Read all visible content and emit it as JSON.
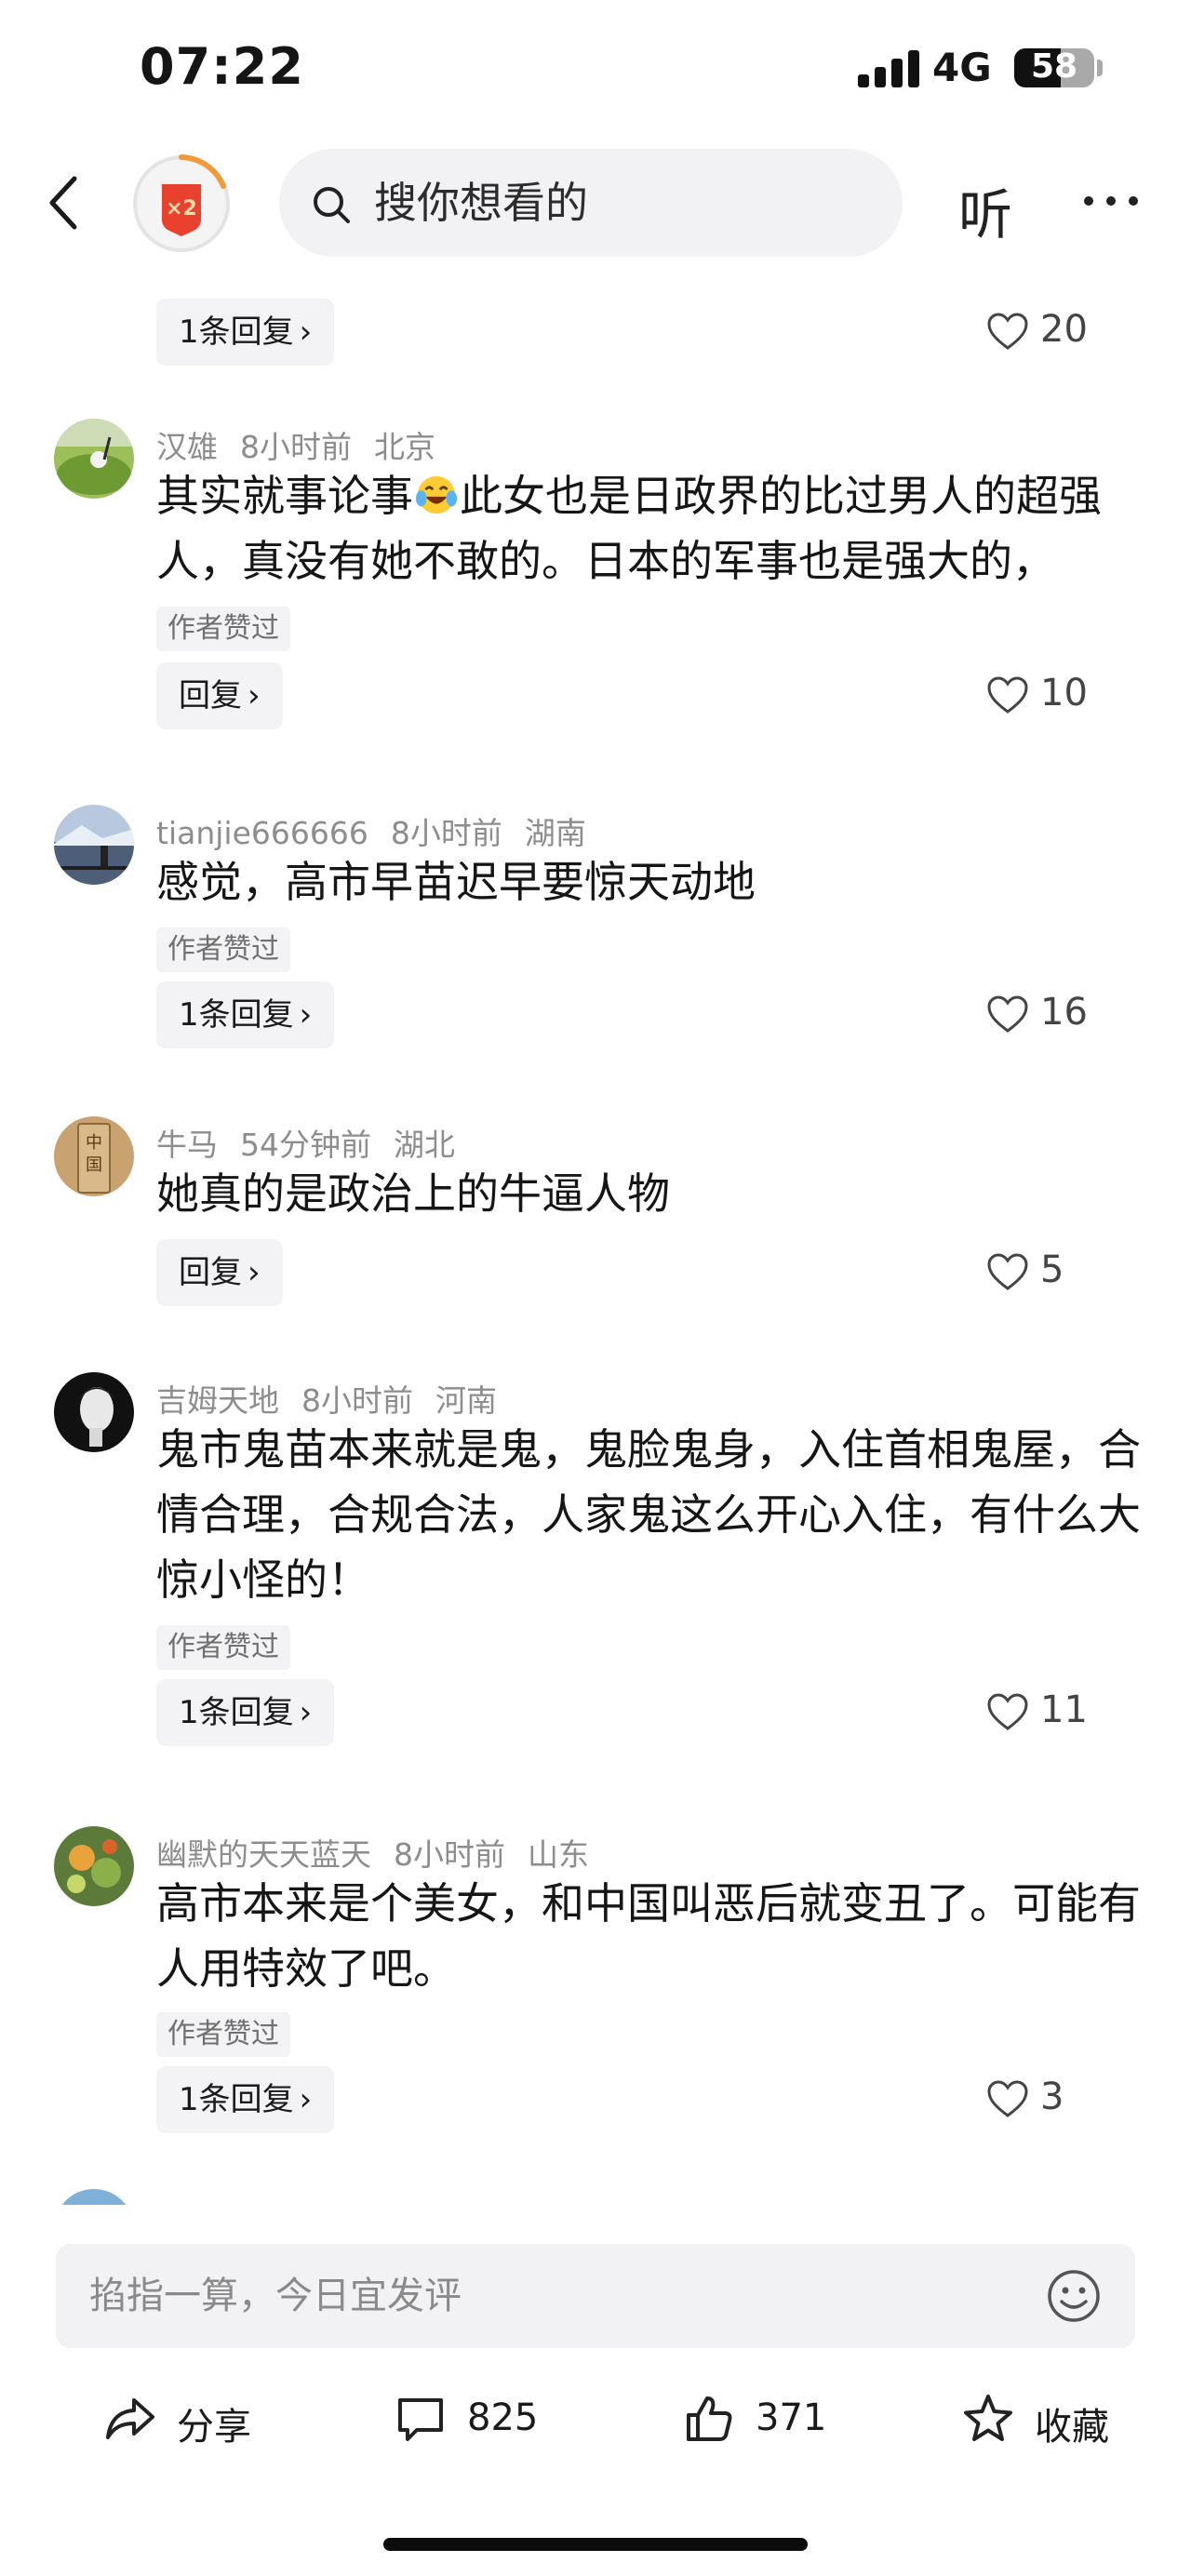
{
  "status_bar": {
    "time": "07:22",
    "network": "4G",
    "battery": "58"
  },
  "nav": {
    "search_placeholder": "搜你想看的",
    "listen_label": "听",
    "reward_badge": "×2"
  },
  "first_reply": {
    "reply_label": "1条回复",
    "likes": "20"
  },
  "comments": [
    {
      "user": "汉雄",
      "time": "8小时前",
      "location": "北京",
      "text_before": "其实就事论事",
      "text_after": "此女也是日政界的比过男人的超强人，真没有她不敢的。日本的军事也是强大的，",
      "emoji": "laughing-crying-emoji",
      "author_tag": "作者赞过",
      "reply_label": "回复",
      "likes": "10"
    },
    {
      "user": "tianjie666666",
      "time": "8小时前",
      "location": "湖南",
      "text": "感觉，高市早苗迟早要惊天动地",
      "author_tag": "作者赞过",
      "reply_label": "1条回复",
      "likes": "16"
    },
    {
      "user": "牛马",
      "time": "54分钟前",
      "location": "湖北",
      "text": "她真的是政治上的牛逼人物",
      "reply_label": "回复",
      "likes": "5"
    },
    {
      "user": "吉姆天地",
      "time": "8小时前",
      "location": "河南",
      "text": "鬼市鬼苗本来就是鬼，鬼脸鬼身，入住首相鬼屋，合情合理，合规合法，人家鬼这么开心入住，有什么大惊小怪的！",
      "author_tag": "作者赞过",
      "reply_label": "1条回复",
      "likes": "11"
    },
    {
      "user": "幽默的天天蓝天",
      "time": "8小时前",
      "location": "山东",
      "text": "高市本来是个美女，和中国叫恶后就变丑了。可能有人用特效了吧。",
      "author_tag": "作者赞过",
      "reply_label": "1条回复",
      "likes": "3"
    }
  ],
  "comment_bar": {
    "placeholder": "掐指一算，今日宜发评"
  },
  "actions": {
    "share": "分享",
    "comments": "825",
    "likes": "371",
    "favorite": "收藏"
  },
  "colors": {
    "background": "#ffffff",
    "secondary_text": "#8d8d8d",
    "chip_bg": "#f3f3f5",
    "badge_red": "#e8412e"
  }
}
